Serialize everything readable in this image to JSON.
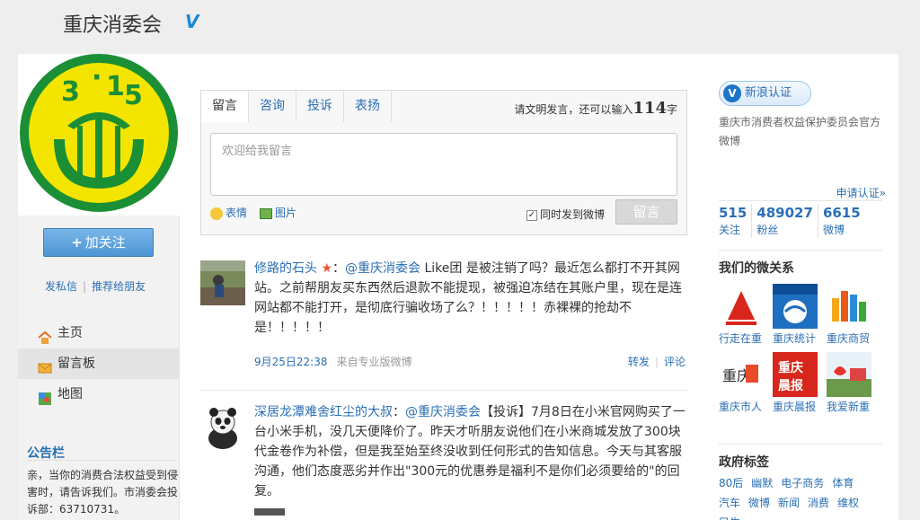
{
  "header": {
    "title": "重庆消委会",
    "verified_mark": "V"
  },
  "profile": {
    "follow_label": "加关注",
    "follow_plus": "+",
    "send_message": "发私信",
    "recommend": "推荐给朋友",
    "link_separator": "|"
  },
  "nav": {
    "items": [
      {
        "label": "主页",
        "icon": "home-icon"
      },
      {
        "label": "留言板",
        "icon": "envelope-icon"
      },
      {
        "label": "地图",
        "icon": "map-icon"
      }
    ]
  },
  "notice": {
    "title": "公告栏",
    "text": "亲，当你的消费合法权益受到侵害时，请告诉我们。市消委会投诉部：63710731。"
  },
  "composer": {
    "tabs": [
      "留言",
      "咨询",
      "投诉",
      "表扬"
    ],
    "remain_prefix": "请文明发言，还可以输入",
    "remain_count": "114",
    "remain_suffix": "字",
    "placeholder": "欢迎给我留言",
    "emoji_label": "表情",
    "image_label": "图片",
    "sync_label": "同时发到微博",
    "sync_checked": "✓",
    "submit_label": "留言"
  },
  "posts": [
    {
      "user": "修路的石头",
      "colon": "：",
      "mention": "@重庆消委会",
      "text": " Like团 是被注销了吗？最近怎么都打不开其网站。之前帮朋友买东西然后退款不能提现，被强迫冻结在其账户里，现在是连网站都不能打开，是彻底行骗收场了么？！！！！！赤裸裸的抢劫不是！！！！！",
      "time": "9月25日22:38",
      "source": "来自专业版微博",
      "forward": "转发",
      "comment": "评论",
      "action_separator": "|"
    },
    {
      "user": "深居龙潭难舍红尘的大叔",
      "colon": "：",
      "mention": "@重庆消委会",
      "text": "【投诉】7月8日在小米官网购买了一台小米手机，没几天便降价了。昨天才听朋友说他们在小米商城发放了300块代金卷作为补偿，但是我至始至终没收到任何形式的告知信息。今天与其客服沟通，他们态度恶劣并作出\"300元的优惠券是福利不是你们必须要给的\"的回复。"
    }
  ],
  "sidebar": {
    "badge_label": "新浪认证",
    "badge_v": "V",
    "description": "重庆市消费者权益保护委员会官方微博",
    "apply_label": "申请认证»",
    "stats": [
      {
        "num": "515",
        "label": "关注"
      },
      {
        "num": "489027",
        "label": "粉丝"
      },
      {
        "num": "6615",
        "label": "微博"
      }
    ],
    "relations_title": "我们的微关系",
    "relations": [
      "行走在重",
      "重庆统计",
      "重庆商贸",
      "重庆市人",
      "重庆晨报",
      "我爱新重"
    ],
    "gov_tags_title": "政府标签",
    "gov_tags": [
      "80后",
      "幽默",
      "电子商务",
      "体育",
      "汽车",
      "微博",
      "新闻",
      "消费",
      "维权",
      "民生"
    ]
  }
}
